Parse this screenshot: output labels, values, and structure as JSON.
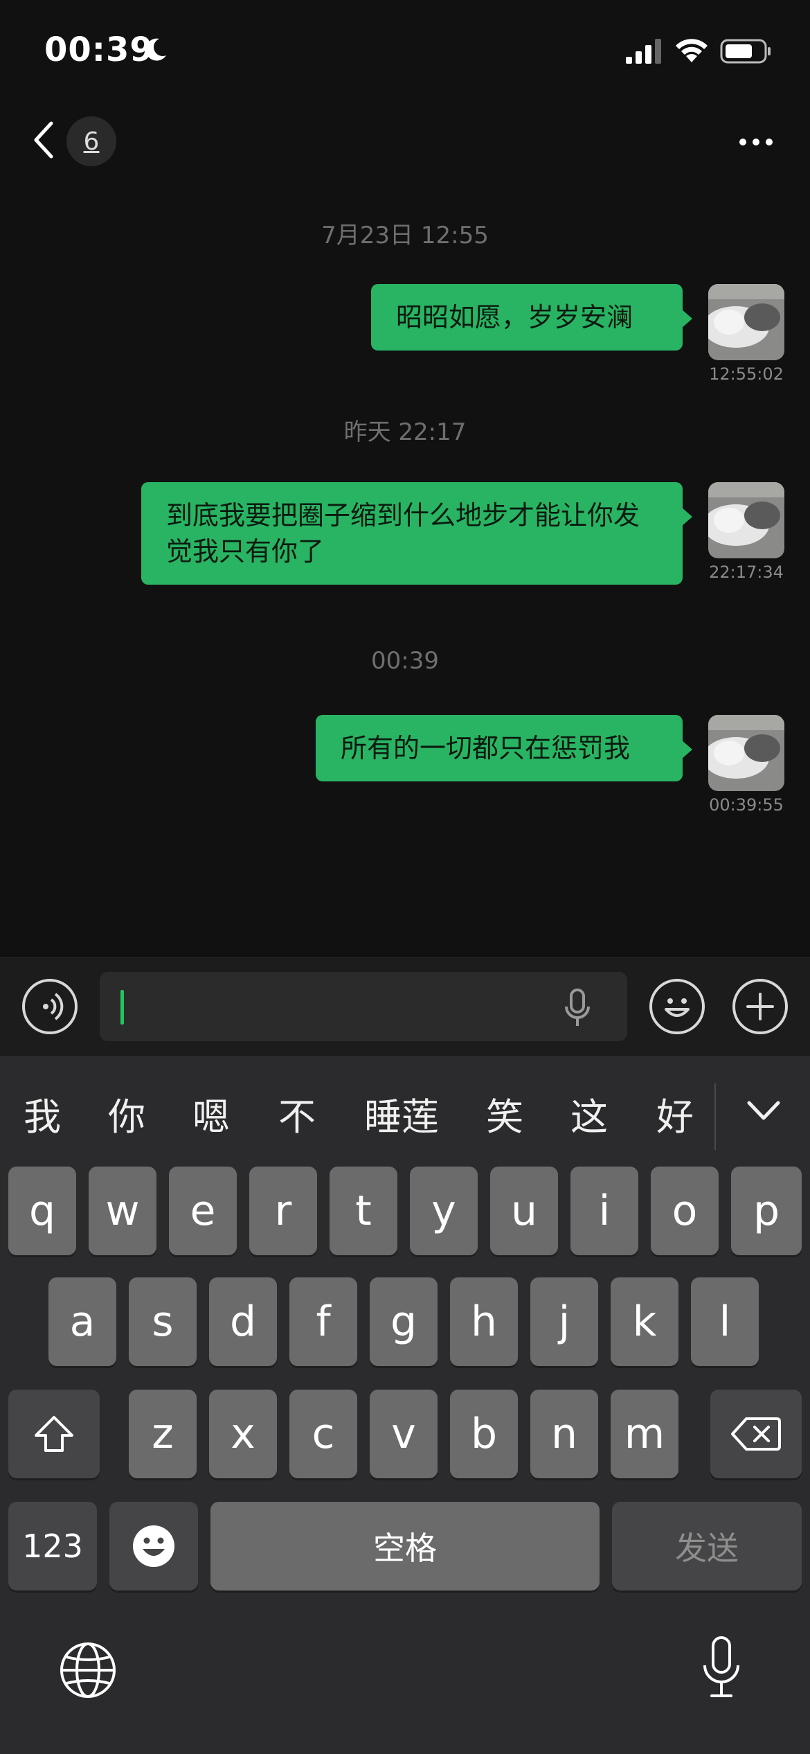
{
  "status_bar": {
    "time": "00:39",
    "moon_icon": "moon-icon",
    "signal_icon": "cellular-signal-icon",
    "wifi_icon": "wifi-icon",
    "battery_icon": "battery-icon"
  },
  "nav": {
    "back_icon": "chevron-left-icon",
    "unread_count": "6",
    "more_icon": "more-dots-icon"
  },
  "messages": [
    {
      "separator": "7月23日 12:55",
      "text": "昭昭如愿，岁岁安澜",
      "time": "12:55:02"
    },
    {
      "separator": "昨天 22:17",
      "text": "到底我要把圈子缩到什么地步才能让你发觉我只有你了",
      "time": "22:17:34"
    },
    {
      "separator": "00:39",
      "text": "所有的一切都只在惩罚我",
      "time": "00:39:55"
    }
  ],
  "input_bar": {
    "voice_icon": "voice-mode-icon",
    "mic_icon": "microphone-icon",
    "emoji_icon": "emoji-icon",
    "plus_icon": "plus-icon",
    "value": ""
  },
  "keyboard": {
    "candidates": [
      "我",
      "你",
      "嗯",
      "不",
      "睡莲",
      "笑",
      "这",
      "好"
    ],
    "collapse_icon": "chevron-down-icon",
    "row1": [
      "q",
      "w",
      "e",
      "r",
      "t",
      "y",
      "u",
      "i",
      "o",
      "p"
    ],
    "row2": [
      "a",
      "s",
      "d",
      "f",
      "g",
      "h",
      "j",
      "k",
      "l"
    ],
    "row3": [
      "z",
      "x",
      "c",
      "v",
      "b",
      "n",
      "m"
    ],
    "shift_icon": "shift-icon",
    "delete_icon": "backspace-icon",
    "numbers_label": "123",
    "emoji_key_icon": "emoji-icon",
    "space_label": "空格",
    "send_label": "发送",
    "globe_icon": "globe-icon",
    "dictation_icon": "microphone-icon"
  },
  "colors": {
    "bubble": "#29b463",
    "background": "#111111",
    "keyboard": "#2b2b2d",
    "cursor": "#22c55e"
  }
}
